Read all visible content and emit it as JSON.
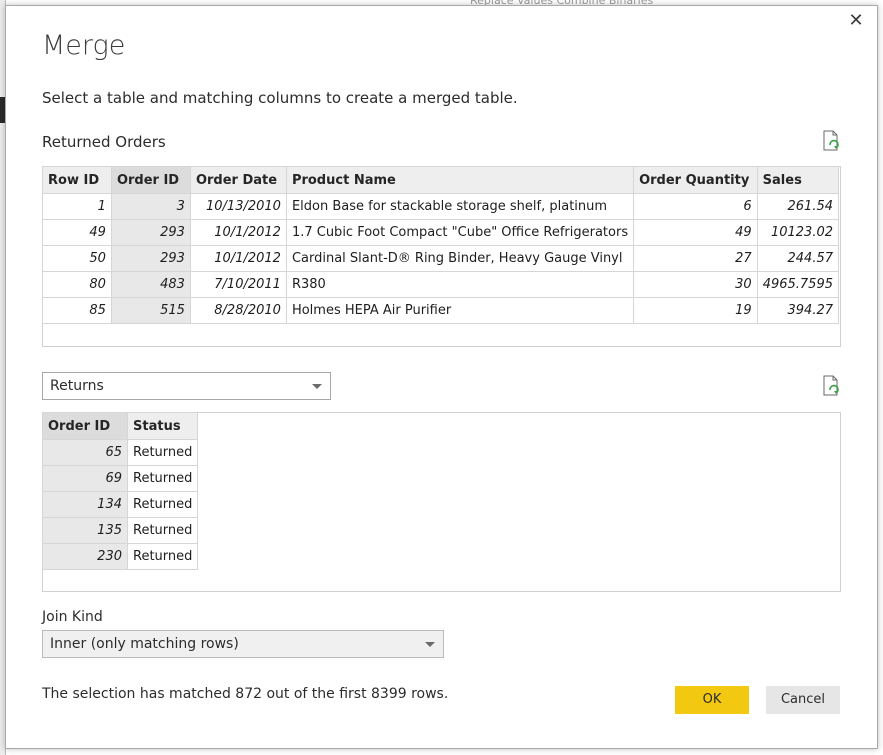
{
  "dialog": {
    "title": "Merge",
    "close_glyph": "✕",
    "subtitle": "Select a table and matching columns to create a merged table."
  },
  "background": {
    "top_text": "Replace Values           Combine Binaries"
  },
  "top_table": {
    "label": "Returned Orders",
    "refresh_icon": "refresh-preview-icon",
    "headers": [
      "Row ID",
      "Order ID",
      "Order Date",
      "Product Name",
      "Order Quantity",
      "Sales"
    ],
    "rows": [
      [
        "1",
        "3",
        "10/13/2010",
        "Eldon Base for stackable storage shelf, platinum",
        "6",
        "261.54"
      ],
      [
        "49",
        "293",
        "10/1/2012",
        "1.7 Cubic Foot Compact \"Cube\" Office Refrigerators",
        "49",
        "10123.02"
      ],
      [
        "50",
        "293",
        "10/1/2012",
        "Cardinal Slant-D® Ring Binder, Heavy Gauge Vinyl",
        "27",
        "244.57"
      ],
      [
        "80",
        "483",
        "7/10/2011",
        "R380",
        "30",
        "4965.7595"
      ],
      [
        "85",
        "515",
        "8/28/2010",
        "Holmes HEPA Air Purifier",
        "19",
        "394.27"
      ]
    ]
  },
  "second_table": {
    "selected": "Returns",
    "refresh_icon": "refresh-preview-icon",
    "headers": [
      "Order ID",
      "Status"
    ],
    "rows": [
      [
        "65",
        "Returned"
      ],
      [
        "69",
        "Returned"
      ],
      [
        "134",
        "Returned"
      ],
      [
        "135",
        "Returned"
      ],
      [
        "230",
        "Returned"
      ]
    ]
  },
  "join": {
    "label": "Join Kind",
    "selected": "Inner (only matching rows)"
  },
  "footer": {
    "status": "The selection has matched 872 out of the first 8399 rows.",
    "ok_label": "OK",
    "cancel_label": "Cancel"
  },
  "colors": {
    "ok_button": "#f2c811",
    "selected_column": "#e8e8e8",
    "header_bg": "#eeeeee"
  }
}
